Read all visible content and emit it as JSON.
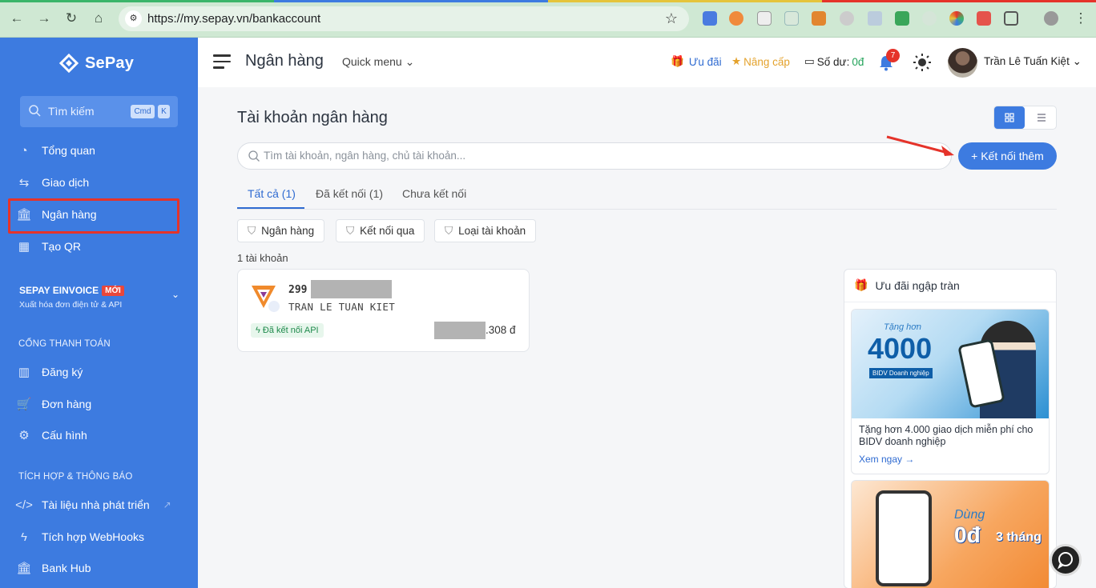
{
  "browser": {
    "url": "https://my.sepay.vn/bankaccount"
  },
  "sidebar": {
    "brand": "SePay",
    "search_placeholder": "Tìm kiếm",
    "shortcut_cmd": "Cmd",
    "shortcut_key": "K",
    "items": [
      {
        "label": "Tổng quan",
        "icon": "dashboard-icon"
      },
      {
        "label": "Giao dịch",
        "icon": "exchange-icon"
      },
      {
        "label": "Ngân hàng",
        "icon": "bank-icon",
        "active": true
      },
      {
        "label": "Tạo QR",
        "icon": "qr-icon"
      }
    ],
    "einvoice": {
      "title": "SEPAY EINVOICE",
      "badge": "MỚI",
      "subtitle": "Xuất hóa đơn điện tử & API"
    },
    "payment_section": "CỔNG THANH TOÁN",
    "payment_items": [
      {
        "label": "Đăng ký",
        "icon": "chart-icon"
      },
      {
        "label": "Đơn hàng",
        "icon": "cart-icon"
      },
      {
        "label": "Cấu hình",
        "icon": "gear-icon"
      }
    ],
    "integration_section": "TÍCH HỢP & THÔNG BÁO",
    "integration_items": [
      {
        "label": "Tài liệu nhà phát triển",
        "icon": "code-icon"
      },
      {
        "label": "Tích hợp WebHooks",
        "icon": "bolt-icon"
      },
      {
        "label": "Bank Hub",
        "icon": "bank-icon"
      }
    ]
  },
  "topbar": {
    "title": "Ngân hàng",
    "quick_menu": "Quick menu",
    "uu_dai": "Ưu đãi",
    "nang_cap": "Nâng cấp",
    "so_du_label": "Số dư:",
    "so_du_value": "0đ",
    "notification_count": "7",
    "user_name": "Trần Lê Tuấn Kiệt"
  },
  "main": {
    "title": "Tài khoản ngân hàng",
    "search_placeholder": "Tìm tài khoản, ngân hàng, chủ tài khoản...",
    "add_button": "+ Kết nối thêm",
    "tabs": [
      "Tất cả (1)",
      "Đã kết nối (1)",
      "Chưa kết nối"
    ],
    "filters": [
      "Ngân hàng",
      "Kết nối qua",
      "Loại tài khoản"
    ],
    "count_text": "1 tài khoản",
    "account": {
      "number_prefix": "299",
      "holder": "TRAN LE TUAN KIET",
      "status": "Đã kết nối API",
      "balance_suffix": ".308 đ"
    },
    "promo": {
      "title": "Ưu đãi ngập tràn",
      "card1_text": "Tặng hơn 4.000 giao dịch miễn phí cho BIDV doanh nghiệp",
      "card1_link": "Xem ngay →",
      "card1_img_title": "4000",
      "card1_img_tang": "Tặng hơn",
      "card1_img_bidv": "BIDV Doanh nghiệp",
      "card2_dung": "Dùng",
      "card2_od": "0đ",
      "card2_thang": "3 tháng"
    }
  },
  "colors": {
    "sidebar": "#3d7be0",
    "accent": "#3d7be0",
    "highlight": "#e5332a"
  }
}
